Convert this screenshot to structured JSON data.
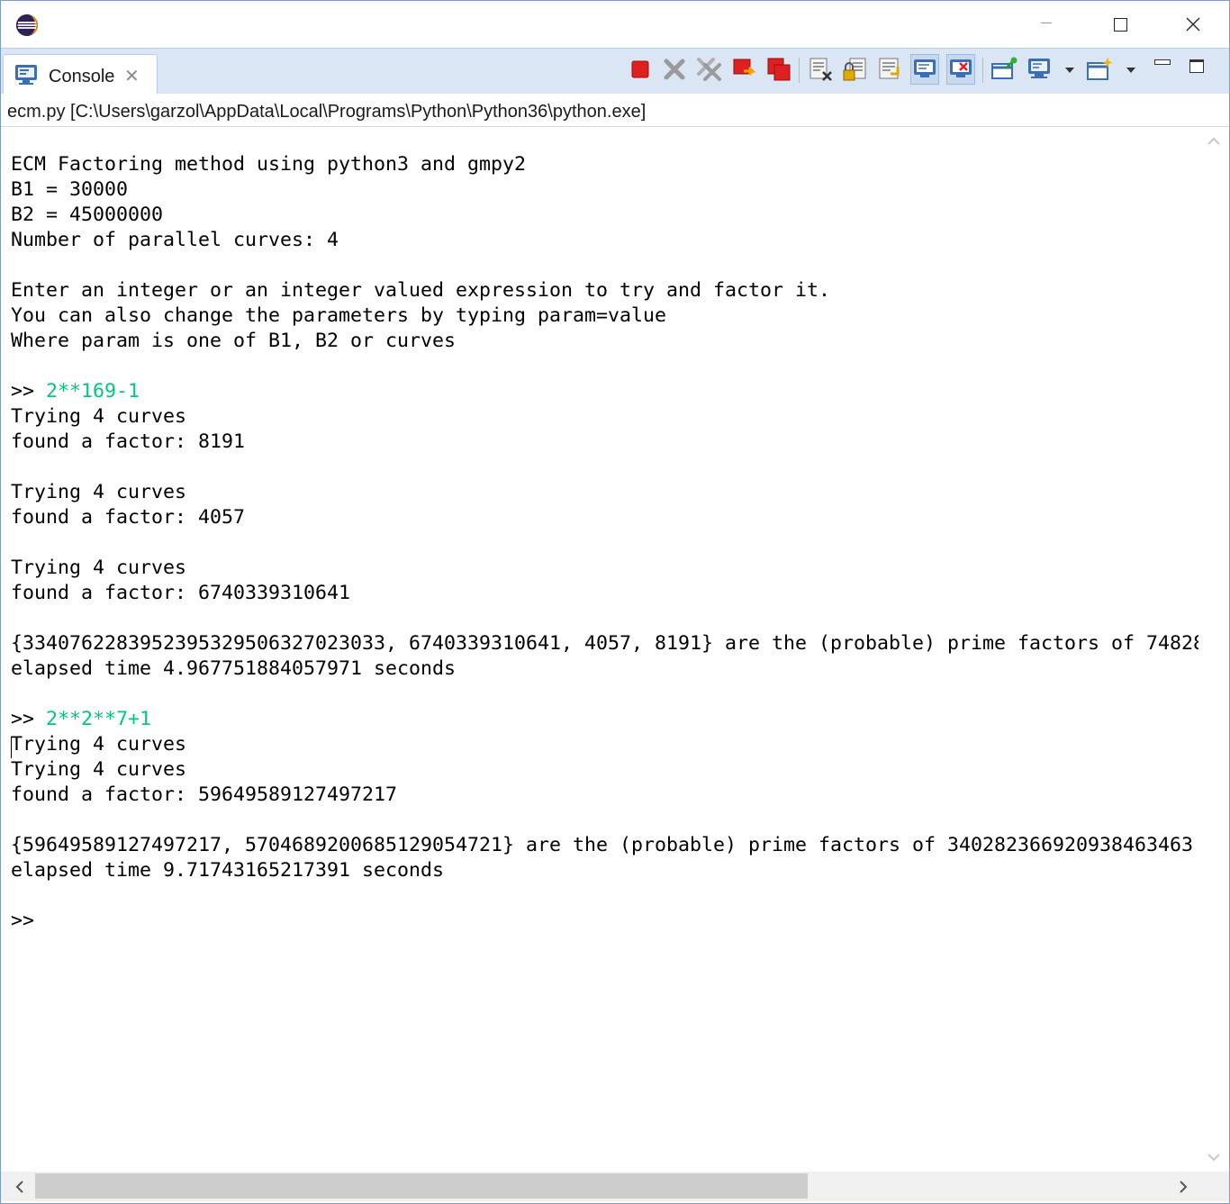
{
  "window": {
    "icons": {
      "app": "eclipse-icon",
      "minimize": "minimize-icon",
      "maximize": "maximize-icon",
      "close": "close-icon"
    }
  },
  "view": {
    "tab_label": "Console",
    "tab_icon": "console-monitor-icon",
    "toolbar": [
      "terminate-icon",
      "remove-launch-icon",
      "remove-all-terminated-icon",
      "new-console-icon",
      "display-selected-console-icon",
      "clear-console-icon",
      "scroll-lock-icon",
      "word-wrap-icon",
      "show-console-on-stdout-icon",
      "show-console-on-stderr-icon",
      "pin-console-icon",
      "display-console-icon",
      "open-console-icon"
    ],
    "colors": {
      "tab_strip": "#dae6f4",
      "stop_red": "#e02020",
      "input_green": "#00c87a"
    }
  },
  "console": {
    "description": "ecm.py [C:\\Users\\garzol\\AppData\\Local\\Programs\\Python\\Python36\\python.exe]",
    "lines": [
      {
        "text": "ECM Factoring method using python3 and gmpy2"
      },
      {
        "text": "B1 = 30000"
      },
      {
        "text": "B2 = 45000000"
      },
      {
        "text": "Number of parallel curves: 4"
      },
      {
        "text": ""
      },
      {
        "text": "Enter an integer or an integer valued expression to try and factor it."
      },
      {
        "text": "You can also change the parameters by typing param=value"
      },
      {
        "text": "Where param is one of B1, B2 or curves"
      },
      {
        "text": ""
      },
      {
        "prompt": ">> ",
        "input": "2**169-1"
      },
      {
        "text": "Trying 4 curves"
      },
      {
        "text": "found a factor: 8191"
      },
      {
        "text": ""
      },
      {
        "text": "Trying 4 curves"
      },
      {
        "text": "found a factor: 4057"
      },
      {
        "text": ""
      },
      {
        "text": "Trying 4 curves"
      },
      {
        "text": "found a factor: 6740339310641"
      },
      {
        "text": ""
      },
      {
        "text": "{3340762283952395329506327023033, 6740339310641, 4057, 8191} are the (probable) prime factors of 74828"
      },
      {
        "text": "elapsed time 4.967751884057971 seconds"
      },
      {
        "text": ""
      },
      {
        "prompt": ">> ",
        "input": "2**2**7+1"
      },
      {
        "text": "Trying 4 curves"
      },
      {
        "text": "Trying 4 curves"
      },
      {
        "text": "found a factor: 59649589127497217"
      },
      {
        "text": ""
      },
      {
        "text": "{59649589127497217, 5704689200685129054721} are the (probable) prime factors of 340282366920938463463"
      },
      {
        "text": "elapsed time 9.71743165217391 seconds"
      },
      {
        "text": ""
      },
      {
        "prompt": ">>",
        "input": ""
      }
    ]
  },
  "scrollbars": {
    "vertical": {
      "up": "chevron-up-icon",
      "down": "chevron-down-icon"
    },
    "horizontal": {
      "left": "chevron-left-icon",
      "right": "chevron-right-icon",
      "thumb_fraction": 0.68
    }
  }
}
